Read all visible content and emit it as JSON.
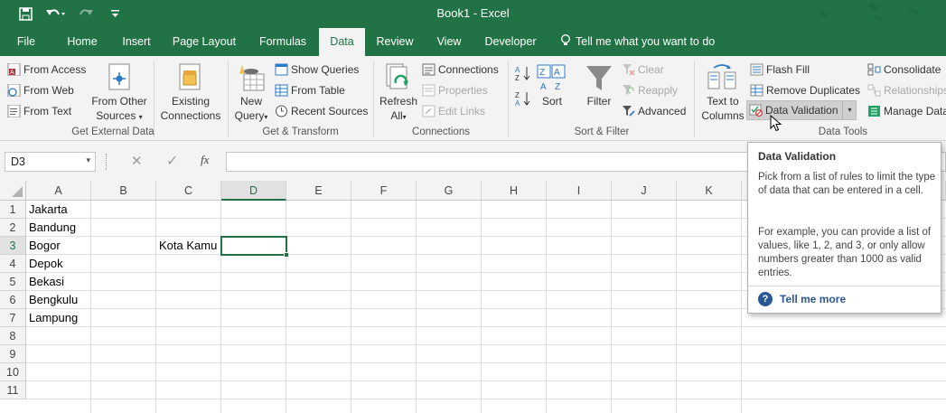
{
  "titlebar": {
    "title": "Book1  -  Excel",
    "save_icon": "save-icon",
    "undo_icon": "undo-icon",
    "redo_icon": "redo-icon",
    "customize_icon": "customize-qat-icon"
  },
  "tabs": [
    {
      "label": "File"
    },
    {
      "label": "Home"
    },
    {
      "label": "Insert"
    },
    {
      "label": "Page Layout"
    },
    {
      "label": "Formulas"
    },
    {
      "label": "Data"
    },
    {
      "label": "Review"
    },
    {
      "label": "View"
    },
    {
      "label": "Developer"
    }
  ],
  "tell_me": "Tell me what you want to do",
  "ribbon": {
    "get_external_data": {
      "label": "Get External Data",
      "from_access": "From Access",
      "from_web": "From Web",
      "from_text": "From Text",
      "from_other_sources_1": "From Other",
      "from_other_sources_2": "Sources",
      "existing_connections_1": "Existing",
      "existing_connections_2": "Connections"
    },
    "get_transform": {
      "label": "Get & Transform",
      "new_query_1": "New",
      "new_query_2": "Query",
      "show_queries": "Show Queries",
      "from_table": "From Table",
      "recent_sources": "Recent Sources"
    },
    "connections": {
      "label": "Connections",
      "refresh_all_1": "Refresh",
      "refresh_all_2": "All",
      "connections": "Connections",
      "properties": "Properties",
      "edit_links": "Edit Links"
    },
    "sort_filter": {
      "label": "Sort & Filter",
      "sort": "Sort",
      "filter": "Filter",
      "clear": "Clear",
      "reapply": "Reapply",
      "advanced": "Advanced"
    },
    "data_tools": {
      "label": "Data Tools",
      "text_to_columns_1": "Text to",
      "text_to_columns_2": "Columns",
      "flash_fill": "Flash Fill",
      "remove_duplicates": "Remove Duplicates",
      "data_validation": "Data Validation",
      "consolidate": "Consolidate",
      "relationships": "Relationships",
      "manage_data_model": "Manage Data"
    }
  },
  "formula_bar": {
    "name_box": "D3",
    "fx": "fx",
    "value": ""
  },
  "columns": [
    "A",
    "B",
    "C",
    "D",
    "E",
    "F",
    "G",
    "H",
    "I",
    "J",
    "K"
  ],
  "rows": [
    "1",
    "2",
    "3",
    "4",
    "5",
    "6",
    "7",
    "8",
    "9",
    "10",
    "11"
  ],
  "cells": {
    "A1": "Jakarta",
    "A2": "Bandung",
    "A3": "Bogor",
    "A4": "Depok",
    "A5": "Bekasi",
    "A6": "Bengkulu",
    "A7": "Lampung",
    "C3": "Kota Kamu"
  },
  "selected_cell": "D3",
  "tooltip": {
    "title": "Data Validation",
    "p1": "Pick from a list of rules to limit the type of data that can be entered in a cell.",
    "p2": "For example, you can provide a list of values, like 1, 2, and 3, or only allow numbers greater than 1000 as valid entries.",
    "more": "Tell me more"
  },
  "colors": {
    "brand": "#217346",
    "link": "#2b5797"
  }
}
